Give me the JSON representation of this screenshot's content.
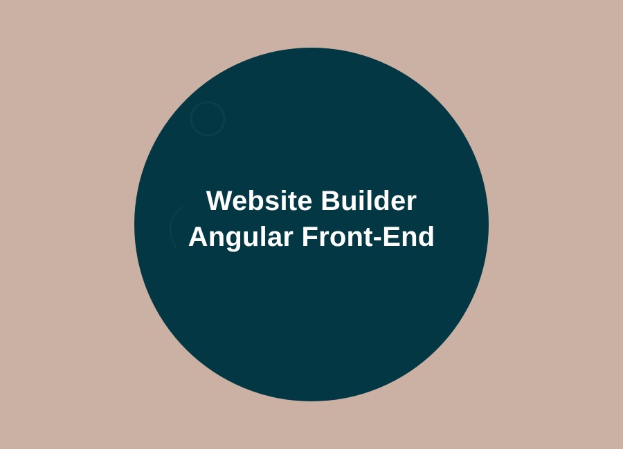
{
  "banner": {
    "title_line_1": "Website Builder",
    "title_line_2": "Angular Front-End"
  },
  "colors": {
    "background": "#cbb1a3",
    "circle": "#043744",
    "text": "#ffffff"
  }
}
